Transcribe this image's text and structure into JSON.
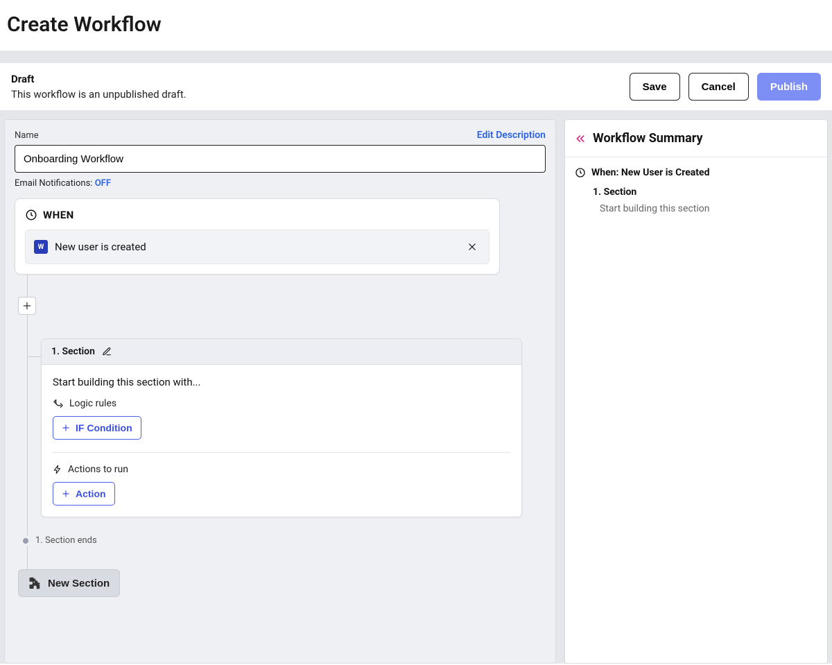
{
  "page": {
    "title": "Create Workflow"
  },
  "draft": {
    "label": "Draft",
    "subtext": "This workflow is an unpublished draft.",
    "save_label": "Save",
    "cancel_label": "Cancel",
    "publish_label": "Publish"
  },
  "canvas": {
    "name_label": "Name",
    "edit_description_label": "Edit Description",
    "name_value": "Onboarding Workflow",
    "email_notif_label": "Email Notifications:",
    "email_notif_status": "OFF",
    "when": {
      "heading": "WHEN",
      "trigger_badge": "W",
      "trigger_label": "New user is created"
    },
    "section": {
      "title": "1.  Section",
      "prompt": "Start building this section with...",
      "logic_heading": "Logic rules",
      "if_condition_label": "IF Condition",
      "actions_heading": "Actions to run",
      "action_label": "Action",
      "ends_label": "1. Section ends"
    },
    "new_section_label": "New Section"
  },
  "summary": {
    "title": "Workflow Summary",
    "when_line": "When: New User is Created",
    "section_label": "1. Section",
    "section_sub": "Start building this section"
  }
}
